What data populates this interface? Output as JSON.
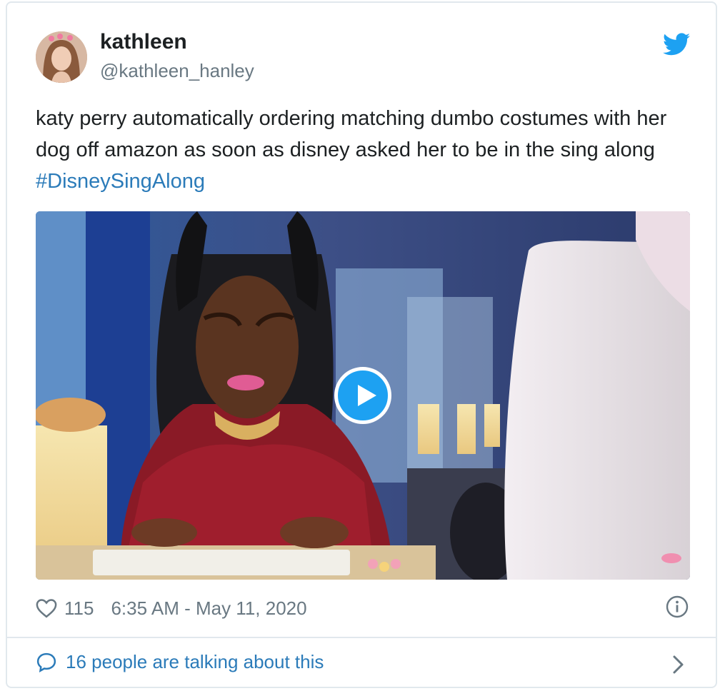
{
  "user": {
    "name": "kathleen",
    "handle": "@kathleen_hanley"
  },
  "tweet": {
    "text": "katy perry automatically ordering matching dumbo costumes with her dog off amazon as soon as disney asked her to be in the sing along ",
    "hashtag": "#DisneySingAlong"
  },
  "media": {
    "type": "video",
    "play_icon": "play-icon"
  },
  "footer": {
    "likes": "115",
    "timestamp": "6:35 AM - May 11, 2020",
    "talking": "16 people are talking about this"
  },
  "colors": {
    "link": "#2b7bb9",
    "brand": "#1da1f2",
    "muted": "#697882",
    "border": "#e1e8ed"
  }
}
